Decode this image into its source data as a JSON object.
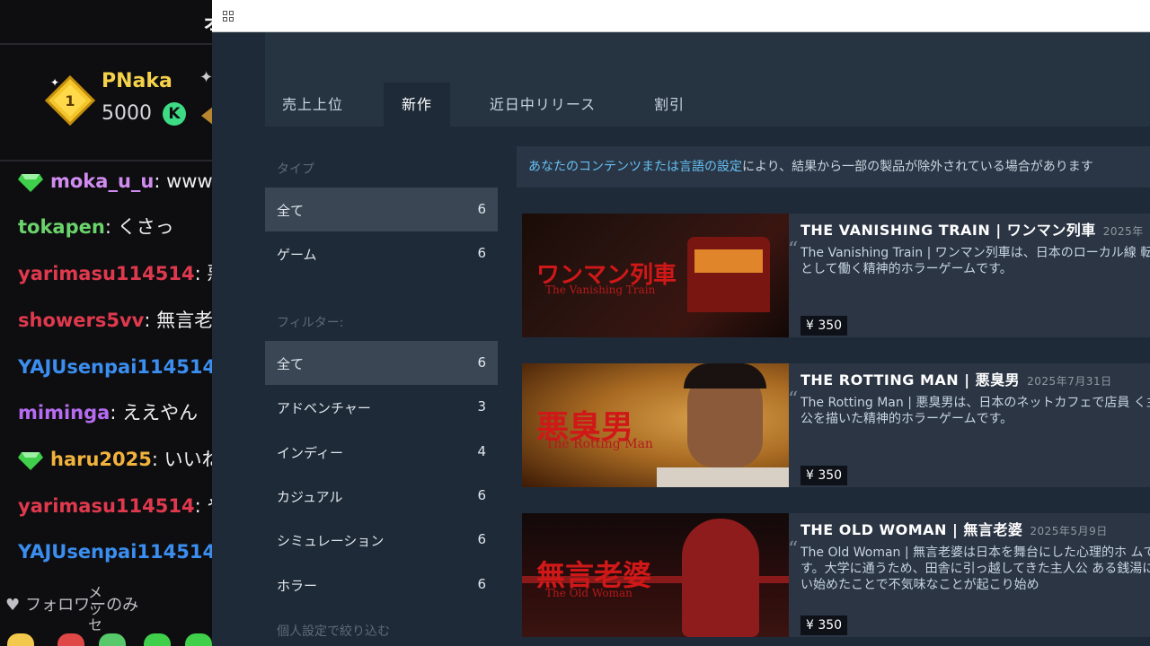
{
  "chat": {
    "top_glyph": "ォ",
    "leader": {
      "rank": "1",
      "name": "PNaka",
      "points": "5000",
      "points_icon": "K"
    },
    "messages": [
      {
        "user": "moka_u_u",
        "text": ": www",
        "color": "#d18cf2",
        "gem": "#3fcf4b"
      },
      {
        "user": "tokapen",
        "text": ": くさっ",
        "color": "#6bd36b",
        "gem": ""
      },
      {
        "user": "yarimasu114514",
        "text": ": 悪臭",
        "color": "#e0394e",
        "gem": ""
      },
      {
        "user": "showers5vv",
        "text": ": 無言老",
        "color": "#e0394e",
        "gem": ""
      },
      {
        "user": "YAJUsenpai114514",
        "text": ":",
        "color": "#3b8ef0",
        "gem": ""
      },
      {
        "user": "miminga",
        "text": ": ええやん",
        "color": "#b56cf0",
        "gem": ""
      },
      {
        "user": "haru2025",
        "text": ": いいね",
        "color": "#f2b33d",
        "gem": "#3fcf4b"
      },
      {
        "user": "yarimasu114514",
        "text": ": やー",
        "color": "#e0394e",
        "gem": ""
      },
      {
        "user": "YAJUsenpai114514",
        "text": ":",
        "color": "#3b8ef0",
        "gem": ""
      }
    ],
    "followers_only": "フォロワーのみ",
    "followers_extra": "メッセ"
  },
  "store": {
    "tabs": [
      "売上上位",
      "新作",
      "近日中リリース",
      "割引"
    ],
    "active_tab": 1,
    "type_label": "タイプ",
    "type_facets": [
      {
        "label": "全て",
        "count": "6"
      },
      {
        "label": "ゲーム",
        "count": "6"
      }
    ],
    "filter_label": "フィルター:",
    "filter_facets": [
      {
        "label": "全て",
        "count": "6"
      },
      {
        "label": "アドベンチャー",
        "count": "3"
      },
      {
        "label": "インディー",
        "count": "4"
      },
      {
        "label": "カジュアル",
        "count": "6"
      },
      {
        "label": "シミュレーション",
        "count": "6"
      },
      {
        "label": "ホラー",
        "count": "6"
      }
    ],
    "personal_label": "個人設定で絞り込む",
    "notice_link": "あなたのコンテンツまたは言語の設定",
    "notice_rest": "により、結果から一部の製品が除外されている場合があります",
    "games": [
      {
        "title": "THE VANISHING TRAIN | ワンマン列車",
        "date": "2025年",
        "desc": "The Vanishing Train | ワンマン列車は、日本のローカル線 転士として働く精神的ホラーゲームです。",
        "price": "¥ 350",
        "thumb_jp": "ワンマン列車",
        "thumb_en": "The Vanishing Train"
      },
      {
        "title": "THE ROTTING MAN | 悪臭男",
        "date": "2025年7月31日",
        "desc": "The Rotting Man | 悪臭男は、日本のネットカフェで店員 く主人公を描いた精神的ホラーゲームです。",
        "price": "¥ 350",
        "thumb_jp": "悪臭男",
        "thumb_en": "The Rotting Man"
      },
      {
        "title": "THE OLD WOMAN | 無言老婆",
        "date": "2025年5月9日",
        "desc": "The Old Woman | 無言老婆は日本を舞台にした心理的ホ ムです。大学に通うため、田舎に引っ越してきた主人公 ある銭湯に通い始めたことで不気味なことが起こり始め",
        "price": "¥ 350",
        "thumb_jp": "無言老婆",
        "thumb_en": "The Old Woman"
      }
    ]
  }
}
